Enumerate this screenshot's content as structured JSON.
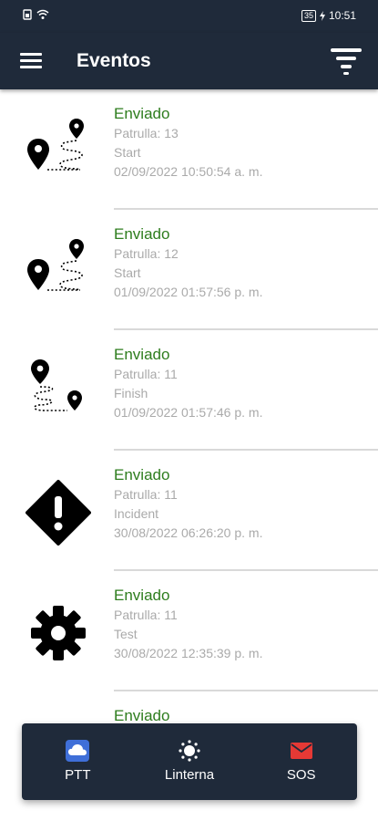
{
  "statusbar": {
    "battery": "35",
    "time": "10:51"
  },
  "appbar": {
    "title": "Eventos"
  },
  "events": [
    {
      "icon": "route-start-icon",
      "status": "Enviado",
      "patrol": "Patrulla: 13",
      "type": "Start",
      "datetime": "02/09/2022 10:50:54 a. m."
    },
    {
      "icon": "route-start-icon",
      "status": "Enviado",
      "patrol": "Patrulla: 12",
      "type": "Start",
      "datetime": "01/09/2022 01:57:56 p. m."
    },
    {
      "icon": "route-finish-icon",
      "status": "Enviado",
      "patrol": "Patrulla: 11",
      "type": "Finish",
      "datetime": "01/09/2022 01:57:46 p. m."
    },
    {
      "icon": "incident-warning-icon",
      "status": "Enviado",
      "patrol": "Patrulla: 11",
      "type": "Incident",
      "datetime": "30/08/2022 06:26:20 p. m."
    },
    {
      "icon": "gear-icon",
      "status": "Enviado",
      "patrol": "Patrulla: 11",
      "type": "Test",
      "datetime": "30/08/2022 12:35:39 p. m."
    },
    {
      "icon": "",
      "status": "Enviado",
      "patrol": "",
      "type": "",
      "datetime": ""
    }
  ],
  "bottombar": {
    "ptt_label": "PTT",
    "flashlight_label": "Linterna",
    "sos_label": "SOS"
  },
  "colors": {
    "primary": "#1f2a3a",
    "status_green": "#2e7d1e",
    "secondary_text": "#aaaaaa",
    "ptt_blue": "#3f6fd8",
    "sos_red": "#e53935"
  }
}
